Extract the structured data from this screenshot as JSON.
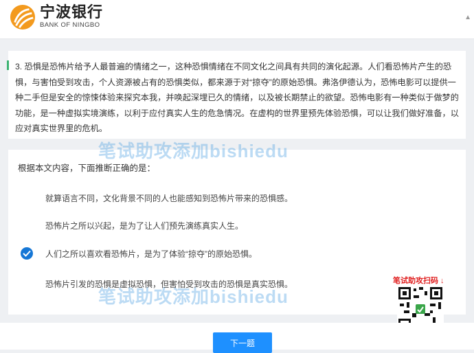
{
  "header": {
    "brand_cn": "宁波银行",
    "brand_en": "BANK OF NINGBO"
  },
  "passage": {
    "text": "3.  恐惧是恐怖片给予人最普遍的情绪之一，这种恐惧情绪在不同文化之间具有共同的演化起源。人们看恐怖片产生的恐惧，与害怕受到攻击，个人资源被占有的恐惧类似，都来源于对“掠夺”的原始恐惧。弗洛伊德认为，恐怖电影可以提供一种二手但是安全的惊悚体验来探究本我，并唤起深埋已久的情绪，以及被长期禁止的欲望。恐怖电影有一种类似于做梦的功能，是一种虚拟实境演练，以利于应付真实人生的危急情况。在虚构的世界里预先体验恐惧，可以让我们做好准备，以应对真实世界里的危机。"
  },
  "question": {
    "stem": "根据本文内容，下面推断正确的是：",
    "options": [
      {
        "text": "就算语言不同，文化背景不同的人也能感知到恐怖片带来的恐惧感。",
        "selected": false
      },
      {
        "text": "恐怖片之所以兴起，是为了让人们预先演练真实人生。",
        "selected": false
      },
      {
        "text": "人们之所以喜欢看恐怖片，是为了体验“掠夺”的原始恐惧。",
        "selected": true
      },
      {
        "text": "恐怖片引发的恐惧是虚拟恐惧，但害怕受到攻击的恐惧是真实恐惧。",
        "selected": false
      }
    ]
  },
  "watermark": {
    "text": "笔试助攻添加bishiedu"
  },
  "qr": {
    "label": "笔试助攻扫码 ↓"
  },
  "footer": {
    "next_label": "下一题"
  },
  "colors": {
    "accent": "#1e90ff",
    "check": "#1677d6",
    "passage_bar": "#3cb371",
    "logo_orange": "#f39a1e",
    "qr_label": "#e02020"
  }
}
